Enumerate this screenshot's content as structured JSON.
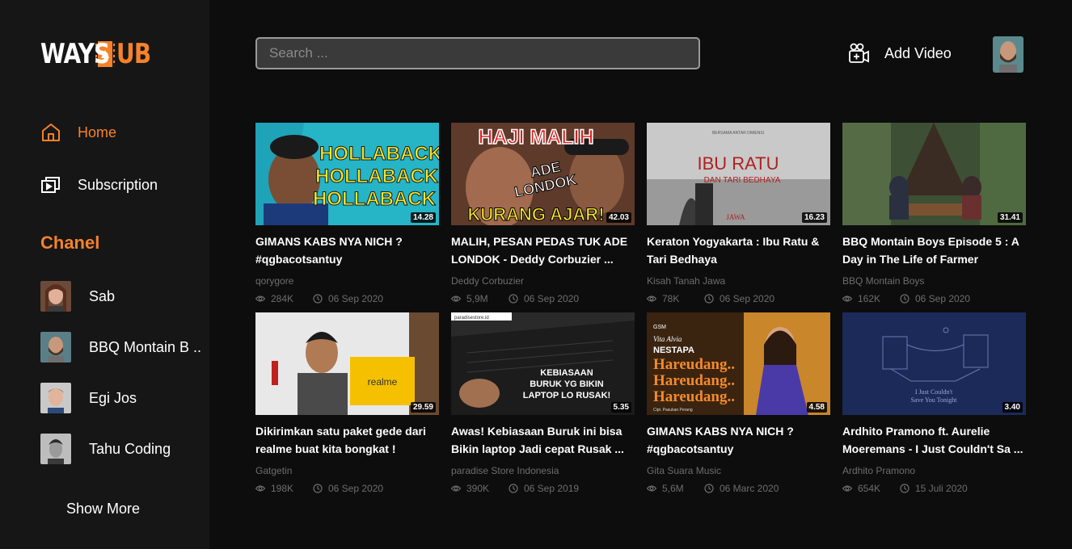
{
  "logo": {
    "part1": "WAYS",
    "part2": "UB"
  },
  "nav": {
    "home": {
      "label": "Home",
      "icon": "home-icon"
    },
    "subscription": {
      "label": "Subscription",
      "icon": "subscription-icon"
    }
  },
  "chanel": {
    "heading": "Chanel",
    "items": [
      {
        "name": "Sab"
      },
      {
        "name": "BBQ Montain B .."
      },
      {
        "name": "Egi Jos"
      },
      {
        "name": "Tahu Coding"
      }
    ],
    "show_more": "Show More"
  },
  "header": {
    "search_placeholder": "Search ...",
    "add_video_label": "Add Video"
  },
  "colors": {
    "accent": "#f5822a",
    "background": "#0d0d0d",
    "sidebar": "#161616"
  },
  "videos": [
    {
      "title": "GIMANS KABS NYA NICH ? #qgbacotsantuy",
      "channel": "qorygore",
      "views": "284K",
      "date": "06 Sep 2020",
      "duration": "14.28",
      "thumb_text": "HOLLABACK"
    },
    {
      "title": "MALIH, PESAN PEDAS TUK ADE LONDOK - Deddy Corbuzier ...",
      "channel": "Deddy Corbuzier",
      "views": "5,9M",
      "date": "06 Sep 2020",
      "duration": "42.03",
      "thumb_text": "HAJI MALIH"
    },
    {
      "title": "Keraton Yogyakarta : Ibu  Ratu & Tari Bedhaya",
      "channel": "Kisah Tanah Jawa",
      "views": "78K",
      "date": "06 Sep 2020",
      "duration": "16.23",
      "thumb_text": "IBU RATU"
    },
    {
      "title": "BBQ Montain Boys Episode 5 : A Day in The Life of Farmer",
      "channel": "BBQ Montain Boys",
      "views": "162K",
      "date": "06 Sep 2020",
      "duration": "31.41",
      "thumb_text": ""
    },
    {
      "title": "Dikirimkan satu paket gede dari realme buat kita bongkat !",
      "channel": "Gatgetin",
      "views": "198K",
      "date": "06 Sep 2020",
      "duration": "29.59",
      "thumb_text": "realme"
    },
    {
      "title": "Awas! Kebiasaan Buruk ini bisa Bikin laptop Jadi cepat Rusak ...",
      "channel": "paradise Store Indonesia",
      "views": "390K",
      "date": "06 Sep 2019",
      "duration": "5.35",
      "thumb_text": "KEBIASAAN BURUK YG BIKIN LAPTOP LO RUSAK!"
    },
    {
      "title": "GIMANS KABS NYA NICH ? #qgbacotsantuy",
      "channel": "Gita Suara Music",
      "views": "5,6M",
      "date": "06 Marc 2020",
      "duration": "4.58",
      "thumb_text": "Hareudang.."
    },
    {
      "title": "Ardhito Pramono ft. Aurelie Moeremans - I Just Couldn't Sa ...",
      "channel": "Ardhito Pramono",
      "views": "654K",
      "date": "15 Juli 2020",
      "duration": "3.40",
      "thumb_text": "I Just Couldn't Save You Tonight"
    }
  ]
}
